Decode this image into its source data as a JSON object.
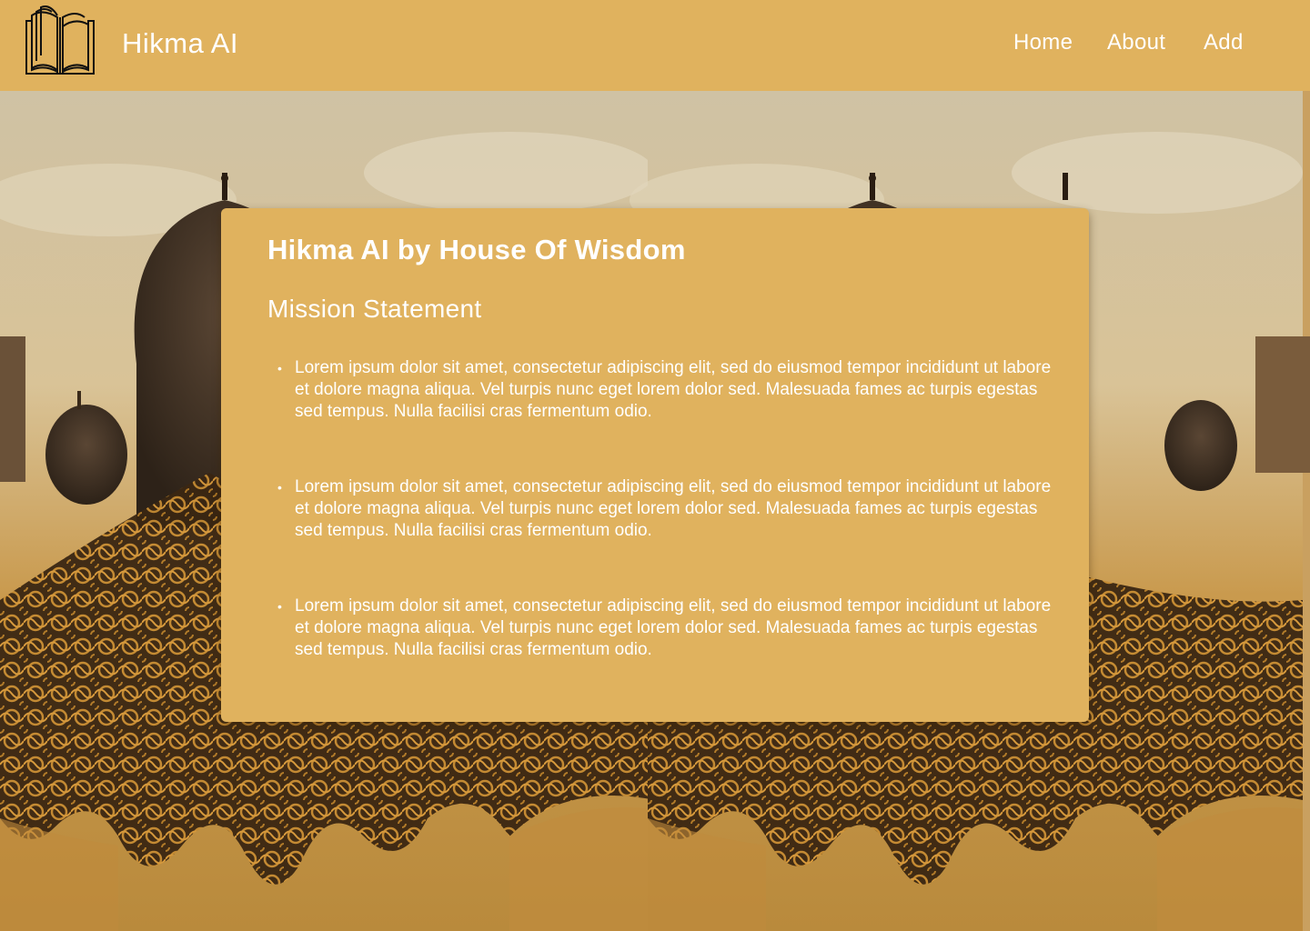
{
  "header": {
    "brand": "Hikma AI",
    "logo_icon": "open-book-icon",
    "nav": [
      {
        "label": "Home"
      },
      {
        "label": "About"
      },
      {
        "label": "Add"
      }
    ]
  },
  "card": {
    "title": "Hikma AI by House Of Wisdom",
    "subtitle": "Mission Statement",
    "bullets": [
      "Lorem ipsum dolor sit amet, consectetur adipiscing elit, sed do eiusmod tempor incididunt ut labore et dolore magna aliqua. Vel turpis nunc eget lorem dolor sed. Malesuada fames ac turpis egestas sed tempus. Nulla facilisi cras fermentum odio.",
      "Lorem ipsum dolor sit amet, consectetur adipiscing elit, sed do eiusmod tempor incididunt ut labore et dolore magna aliqua. Vel turpis nunc eget lorem dolor sed. Malesuada fames ac turpis egestas sed tempus. Nulla facilisi cras fermentum odio.",
      "Lorem ipsum dolor sit amet, consectetur adipiscing elit, sed do eiusmod tempor incididunt ut labore et dolore magna aliqua. Vel turpis nunc eget lorem dolor sed. Malesuada fames ac turpis egestas sed tempus. Nulla facilisi cras fermentum odio."
    ]
  },
  "colors": {
    "accent": "#e0b25e",
    "text": "#ffffff",
    "background_art_dark": "#3a2a1a",
    "background_art_gold": "#b07a2a"
  }
}
